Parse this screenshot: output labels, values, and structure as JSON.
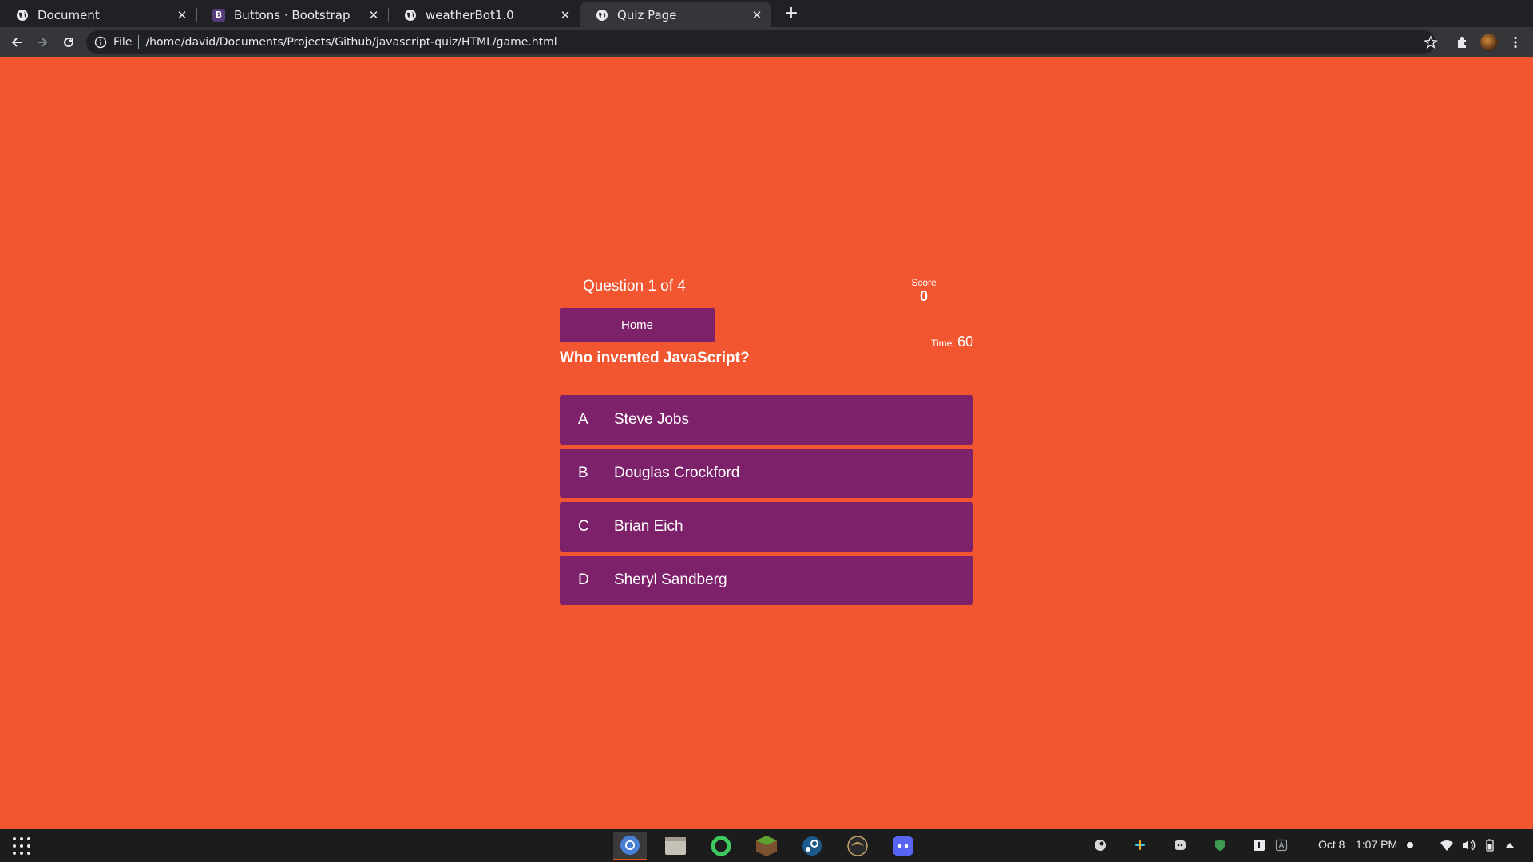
{
  "browser": {
    "tabs": [
      {
        "title": "Document",
        "favicon": "globe-icon"
      },
      {
        "title": "Buttons · Bootstrap",
        "favicon": "bootstrap-icon",
        "favicon_letter": "B"
      },
      {
        "title": "weatherBot1.0",
        "favicon": "globe-icon"
      },
      {
        "title": "Quiz Page",
        "favicon": "globe-icon",
        "active": true
      }
    ],
    "close_glyph": "✕",
    "newtab_glyph": "+",
    "address": {
      "scheme_label": "File",
      "url": "/home/david/Documents/Projects/Github/javascript-quiz/HTML/game.html"
    }
  },
  "quiz": {
    "progress_text": "Question 1 of 4",
    "score_label": "Score",
    "score_value": "0",
    "home_label": "Home",
    "time_label": "Time:",
    "time_value": "60",
    "question": "Who invented JavaScript?",
    "choices": [
      {
        "prefix": "A",
        "text": "Steve Jobs"
      },
      {
        "prefix": "B",
        "text": "Douglas Crockford"
      },
      {
        "prefix": "C",
        "text": "Brian Eich"
      },
      {
        "prefix": "D",
        "text": "Sheryl Sandberg"
      }
    ]
  },
  "taskbar": {
    "dock": [
      "chrome-icon",
      "files-icon",
      "spotify-icon",
      "minecraft-icon",
      "steam-icon",
      "app-icon",
      "discord-icon"
    ],
    "tray": {
      "date": "Oct 8",
      "time": "1:07 PM"
    }
  },
  "colors": {
    "page_bg": "#f25630",
    "button_purple": "#7d216b",
    "chrome_dark": "#202124",
    "chrome_toolbar": "#35363a"
  }
}
